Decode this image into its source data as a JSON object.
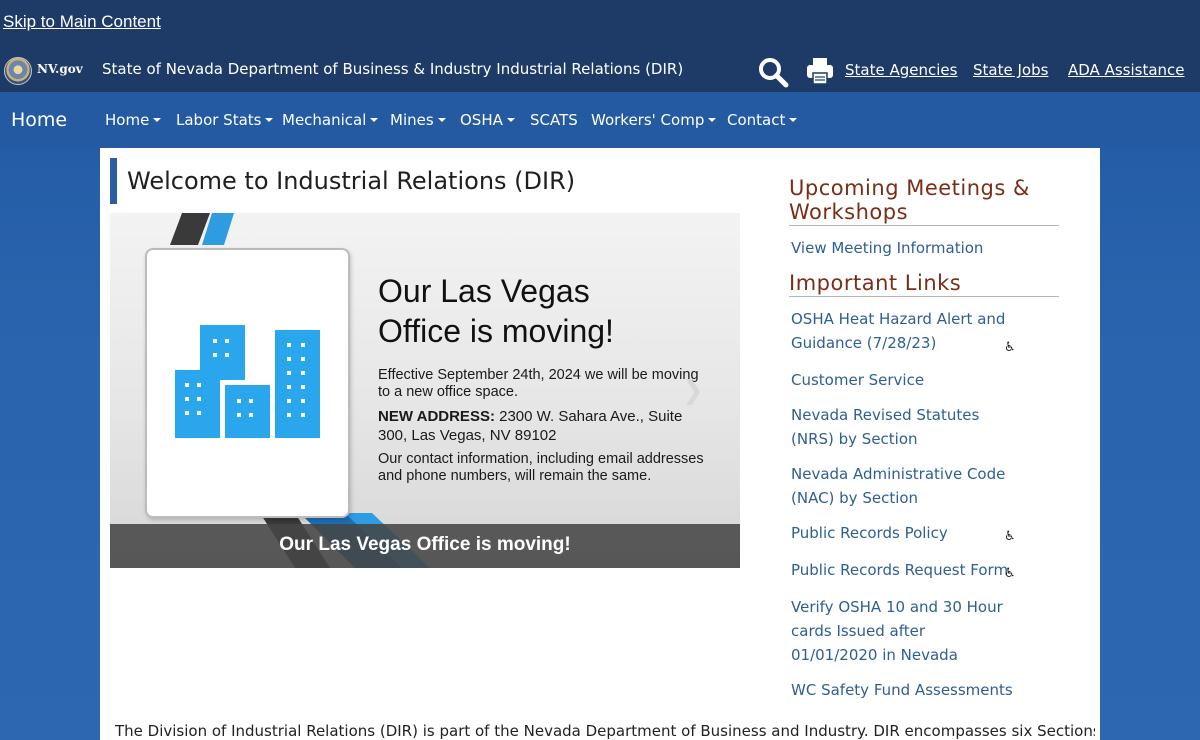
{
  "header": {
    "skip_link": "Skip to Main Content",
    "nv_logo": "NV.gov",
    "agency_title": "State of Nevada Department of Business & Industry Industrial Relations (DIR)",
    "search_icon": "search-icon",
    "print_icon": "print-icon",
    "links": {
      "state_agencies": "State Agencies",
      "state_jobs": "State Jobs",
      "ada_assistance": "ADA Assistance"
    }
  },
  "nav": {
    "brand": "Home",
    "items": [
      "Home",
      "Labor Stats",
      "Mechanical",
      "Mines",
      "OSHA",
      "SCATS",
      "Workers' Comp",
      "Contact"
    ],
    "dropdown_items": [
      "Home",
      "Labor Stats",
      "Mechanical",
      "Mines",
      "OSHA",
      "Workers' Comp",
      "Contact"
    ]
  },
  "main": {
    "title": "Welcome to Industrial Relations (DIR)",
    "slide": {
      "heading_line1": "Our Las Vegas",
      "heading_line2": "Office is moving!",
      "effective": "Effective September 24th, 2024 we will be moving to a new office space.",
      "address_label": "NEW ADDRESS:",
      "address": "2300 W. Sahara Ave., Suite 300, Las Vegas, NV 89102",
      "contact": "Our contact information, including email addresses and phone numbers, will remain the same.",
      "caption": "Our Las Vegas Office is moving!",
      "next_icon": "chevron-right-icon"
    },
    "intro": "The Division of Industrial Relations (DIR) is part of the Nevada Department of Business and Industry. DIR encompasses six Sections: Legal,"
  },
  "sidebar": {
    "meetings_heading": "Upcoming Meetings & Workshops",
    "meetings_link": "View Meeting Information",
    "links_heading": "Important Links",
    "links": [
      {
        "label": "OSHA Heat Hazard Alert and Guidance (7/28/23)",
        "accessible_icon": true
      },
      {
        "label": "Customer Service",
        "accessible_icon": false
      },
      {
        "label": "Nevada Revised Statutes (NRS) by Section",
        "accessible_icon": false
      },
      {
        "label": "Nevada Administrative Code (NAC) by Section",
        "accessible_icon": false
      },
      {
        "label": "Public Records Policy",
        "accessible_icon": true
      },
      {
        "label": "Public Records Request Form",
        "accessible_icon": true
      },
      {
        "label": "Verify OSHA 10 and 30 Hour cards Issued after 01/01/2020 in Nevada",
        "accessible_icon": false
      },
      {
        "label": "WC Safety Fund Assessments",
        "accessible_icon": false
      }
    ],
    "accessible_icon_glyph": "♿"
  },
  "colors": {
    "topbar": "#1d3b66",
    "navbar": "#235aa1",
    "heading": "#7a2e16",
    "link": "#2e5e94",
    "building_blue": "#2aa6ec"
  }
}
